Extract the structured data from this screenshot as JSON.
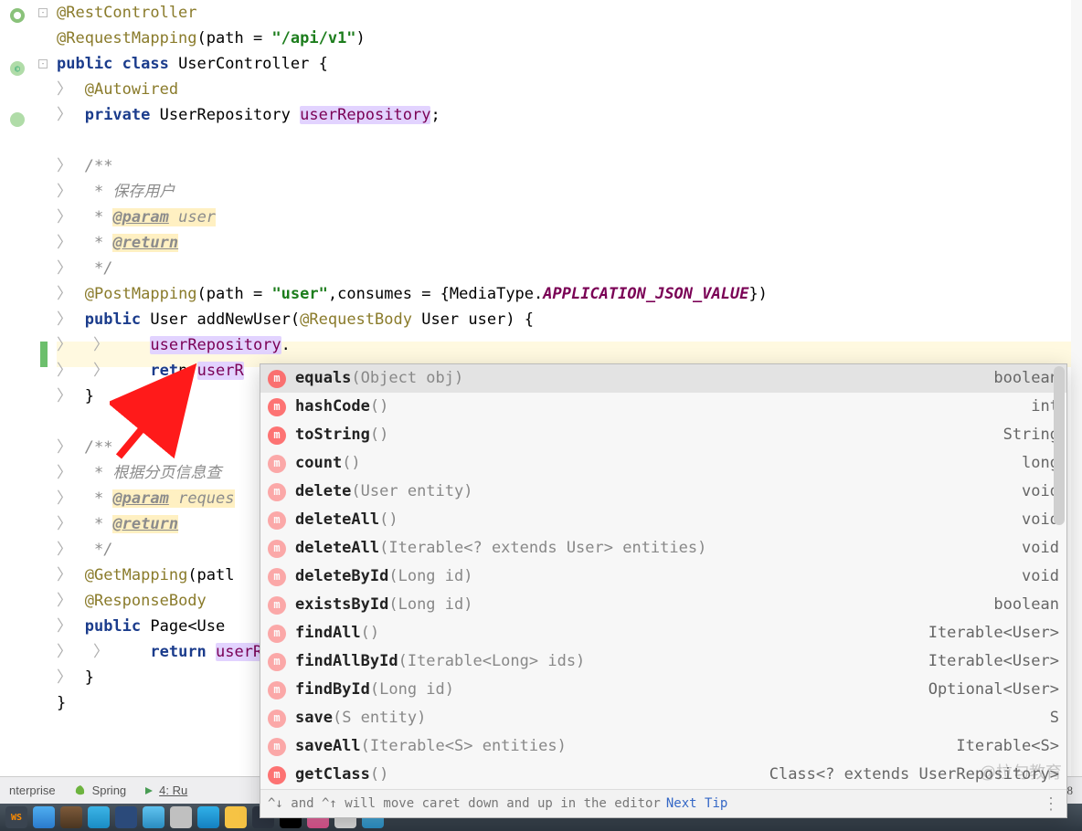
{
  "code": {
    "l1_ann": "@RestController",
    "l2_ann": "@RequestMapping",
    "l2_rest": "(path = ",
    "l2_str": "\"/api/v1\"",
    "l2_end": ")",
    "l3_kw1": "public class ",
    "l3_cls": "UserController {",
    "l4_ann": "@Autowired",
    "l5_kw": "private ",
    "l5_type": "UserRepository ",
    "l5_field": "userRepository",
    "l5_semi": ";",
    "l7_doc": "/**",
    "l8_doc": " * 保存用户",
    "l9_doc": " * ",
    "l9_tag": "@param",
    "l9_name": " user",
    "l10_doc": " * ",
    "l10_tag": "@return",
    "l11_doc": " */",
    "l12_ann": "@PostMapping",
    "l12_a": "(path = ",
    "l12_str": "\"user\"",
    "l12_b": ",consumes = {MediaType.",
    "l12_const": "APPLICATION_JSON_VALUE",
    "l12_c": "})",
    "l13_kw": "public ",
    "l13_type": "User addNewUser(",
    "l13_ann": "@RequestBody",
    "l13_rest": " User user) {",
    "l14_field": "userRepository",
    "l14_dot": ".",
    "l15_kw": "ret",
    "l15_hidden": "n ",
    "l15_field": "userR",
    "l16": "}",
    "l18_doc": "/**",
    "l19_doc": " * 根据分页信息查",
    "l20_doc": " * ",
    "l20_tag": "@param",
    "l20_name": " reques",
    "l21_doc": " * ",
    "l21_tag": "@return",
    "l22_doc": " */",
    "l23_ann": "@GetMapping",
    "l23_rest": "(patl",
    "l24_ann": "@ResponseBody",
    "l25_kw": "public ",
    "l25_type": "Page<Use",
    "l26_kw": "return ",
    "l26_field": "userR",
    "l27": "}",
    "l28": "}"
  },
  "popup": {
    "items": [
      {
        "name": "equals",
        "params": "(Object obj)",
        "ret": "boolean",
        "sel": true,
        "dim": false
      },
      {
        "name": "hashCode",
        "params": "()",
        "ret": "int",
        "dim": false
      },
      {
        "name": "toString",
        "params": "()",
        "ret": "String",
        "dim": false
      },
      {
        "name": "count",
        "params": "()",
        "ret": "long",
        "dim": true
      },
      {
        "name": "delete",
        "params": "(User entity)",
        "ret": "void",
        "dim": true
      },
      {
        "name": "deleteAll",
        "params": "()",
        "ret": "void",
        "dim": true
      },
      {
        "name": "deleteAll",
        "params": "(Iterable<? extends User> entities)",
        "ret": "void",
        "dim": true
      },
      {
        "name": "deleteById",
        "params": "(Long id)",
        "ret": "void",
        "dim": true
      },
      {
        "name": "existsById",
        "params": "(Long id)",
        "ret": "boolean",
        "dim": true
      },
      {
        "name": "findAll",
        "params": "()",
        "ret": "Iterable<User>",
        "dim": true
      },
      {
        "name": "findAllById",
        "params": "(Iterable<Long> ids)",
        "ret": "Iterable<User>",
        "dim": true
      },
      {
        "name": "findById",
        "params": "(Long id)",
        "ret": "Optional<User>",
        "dim": true
      },
      {
        "name": "save",
        "params": "(S entity)",
        "ret": "S",
        "dim": true
      },
      {
        "name": "saveAll",
        "params": "(Iterable<S> entities)",
        "ret": "Iterable<S>",
        "dim": true
      },
      {
        "name": "getClass",
        "params": "()",
        "ret": "Class<? extends UserRepository>",
        "dim": false
      }
    ],
    "footer_text": "^↓ and ^↑ will move caret down and up in the editor",
    "footer_link": "Next Tip"
  },
  "bottombar": {
    "enterprise": "nterprise",
    "spring": "Spring",
    "run": "4: Ru"
  },
  "statusright": "-8",
  "watermark": "@拉勾教育"
}
